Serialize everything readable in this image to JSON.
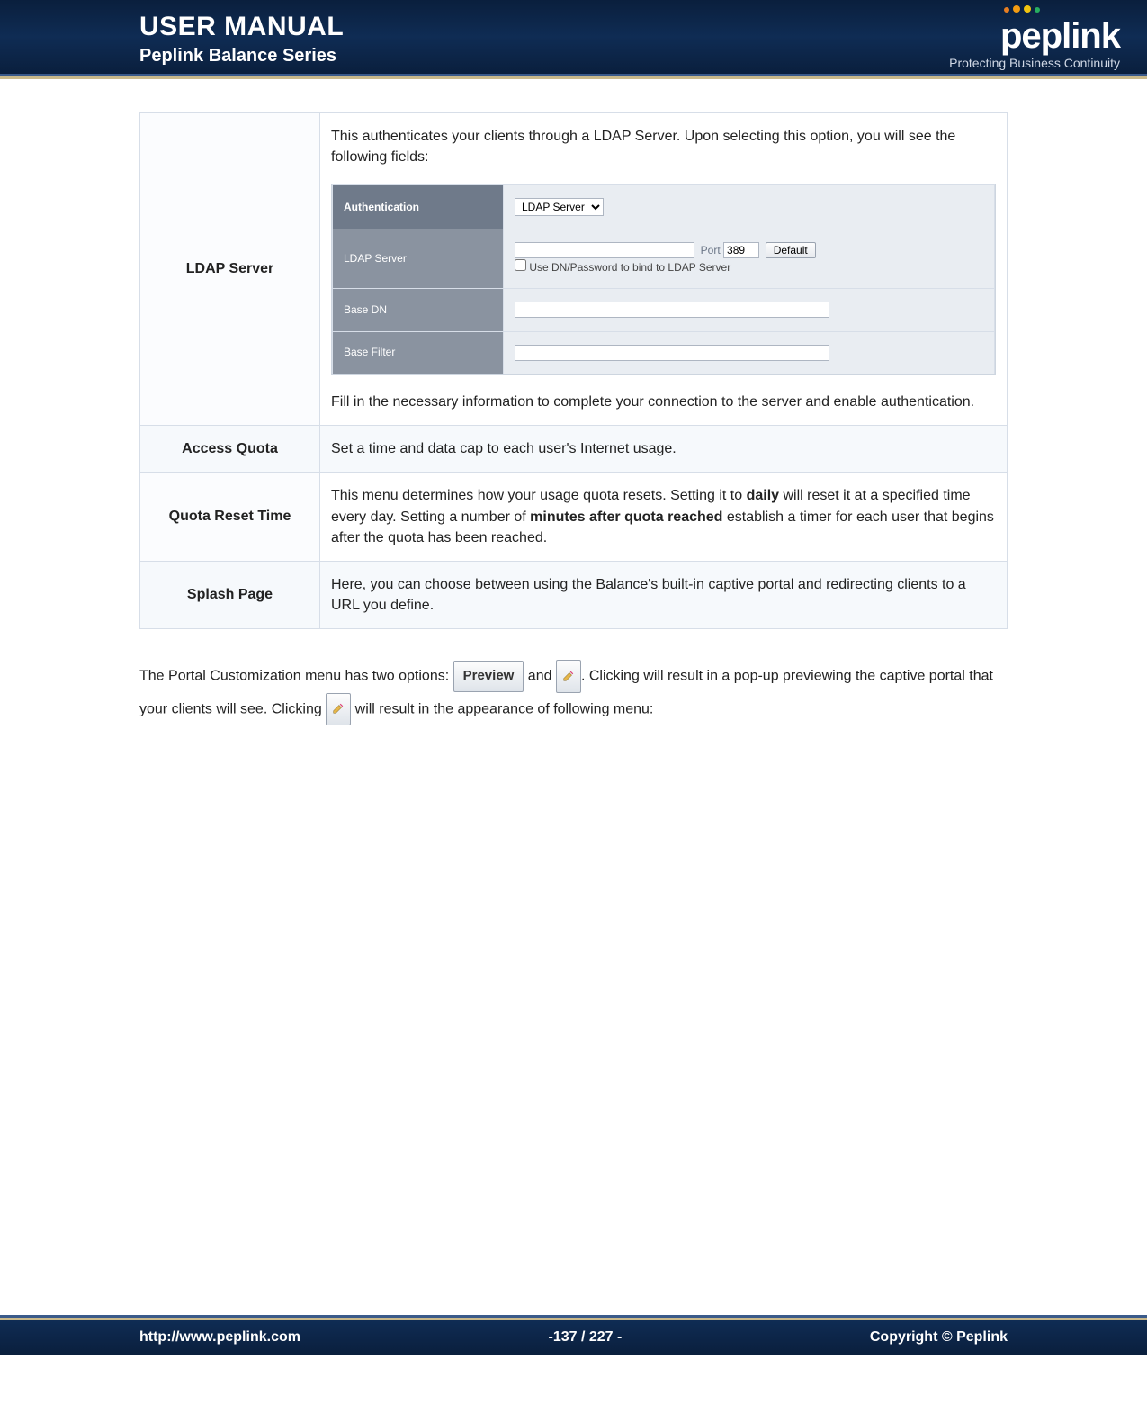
{
  "header": {
    "title": "USER MANUAL",
    "subtitle": "Peplink Balance Series",
    "brand": "peplink",
    "tagline": "Protecting Business Continuity"
  },
  "table": {
    "rows": [
      {
        "label": "LDAP Server",
        "intro": "This authenticates your clients through a LDAP Server. Upon selecting this option, you will see the following fields:",
        "outro": "Fill in the necessary information to complete your connection to the server and enable authentication."
      },
      {
        "label": "Access Quota",
        "desc": "Set a time and data cap to each user's Internet usage."
      },
      {
        "label": "Quota Reset Time",
        "desc_pre": "This menu determines how your usage quota resets. Setting it to ",
        "bold1": "daily",
        "desc_mid": " will reset it at a specified time every day. Setting a number of ",
        "bold2": "minutes after quota reached",
        "desc_post": " establish a timer for each user that begins after the quota has been reached."
      },
      {
        "label": "Splash Page",
        "desc": "Here, you can choose between using the Balance's built-in captive portal and redirecting clients to a URL you define."
      }
    ]
  },
  "ldap_panel": {
    "auth_label": "Authentication",
    "auth_value": "LDAP Server",
    "server_label": "LDAP Server",
    "port_label": "Port",
    "port_value": "389",
    "default_btn": "Default",
    "checkbox_label": "Use DN/Password to bind to LDAP Server",
    "basedn_label": "Base DN",
    "basefilter_label": "Base Filter"
  },
  "paragraph": {
    "p1": "The Portal Customization menu has two options: ",
    "preview_btn": "Preview",
    "p2": " and ",
    "p3": ". Clicking will result in a pop-up previewing the captive portal that your clients will see. Clicking ",
    "p4": " will result in the appearance of following menu:"
  },
  "footer": {
    "url": "http://www.peplink.com",
    "page": "-137 / 227 -",
    "copyright": "Copyright ©  Peplink"
  }
}
